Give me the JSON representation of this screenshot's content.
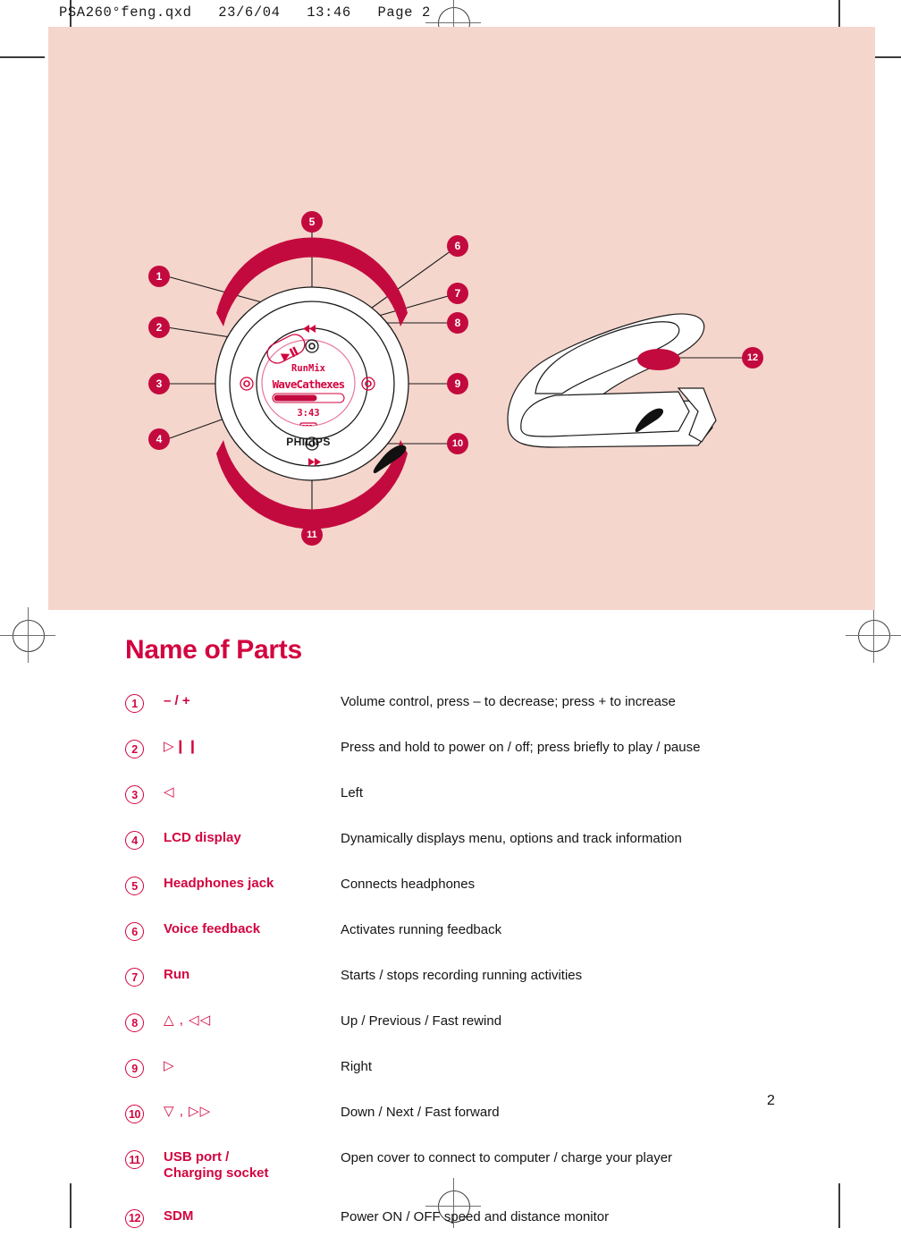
{
  "document": {
    "file_stamp": "PSA260°feng.qxd   23/6/04   13:46   Page 2",
    "page_number": "2",
    "heading": "Name of Parts",
    "accent_color": "#d3043f",
    "panel_color": "#f5d6cc"
  },
  "illustration": {
    "player": {
      "lcd": {
        "menu_line": "RunMix",
        "track_line": "WaveCathexes",
        "time": "3:43",
        "battery_icon": "battery-icon",
        "progress_percent": 62
      },
      "brand_label": "PHILIPS",
      "swoosh_icon": "nike-swoosh-icon",
      "play_pause_icon": "play-pause-icon",
      "rewind_icon": "fast-rewind-icon",
      "forward_icon": "fast-forward-icon",
      "callouts": [
        "1",
        "2",
        "3",
        "4",
        "5",
        "6",
        "7",
        "8",
        "9",
        "10",
        "11"
      ]
    },
    "sdm": {
      "callouts": [
        "12"
      ],
      "swoosh_icon": "nike-swoosh-icon"
    }
  },
  "parts": [
    {
      "num": "1",
      "label": "– / +",
      "is_symbol": false,
      "desc": "Volume control, press – to decrease; press + to increase"
    },
    {
      "num": "2",
      "label": "▷❙❙",
      "is_symbol": true,
      "desc": "Press and hold to power on / off; press briefly to play / pause"
    },
    {
      "num": "3",
      "label": "◁",
      "is_symbol": true,
      "desc": "Left"
    },
    {
      "num": "4",
      "label": "LCD display",
      "is_symbol": false,
      "desc": "Dynamically displays menu, options and track information"
    },
    {
      "num": "5",
      "label": "Headphones jack",
      "is_symbol": false,
      "desc": "Connects headphones"
    },
    {
      "num": "6",
      "label": "Voice feedback",
      "is_symbol": false,
      "desc": "Activates running feedback"
    },
    {
      "num": "7",
      "label": "Run",
      "is_symbol": false,
      "desc": "Starts / stops recording running activities"
    },
    {
      "num": "8",
      "label": "△ , ◁◁",
      "is_symbol": true,
      "desc": "Up / Previous / Fast rewind"
    },
    {
      "num": "9",
      "label": "▷",
      "is_symbol": true,
      "desc": "Right"
    },
    {
      "num": "10",
      "label": "▽ , ▷▷",
      "is_symbol": true,
      "desc": "Down / Next / Fast forward"
    },
    {
      "num": "11",
      "label": "USB port /\nCharging socket",
      "is_symbol": false,
      "desc": "Open cover to connect to computer / charge your player"
    },
    {
      "num": "12",
      "label": "SDM",
      "is_symbol": false,
      "desc": "Power ON / OFF speed and distance monitor"
    }
  ]
}
